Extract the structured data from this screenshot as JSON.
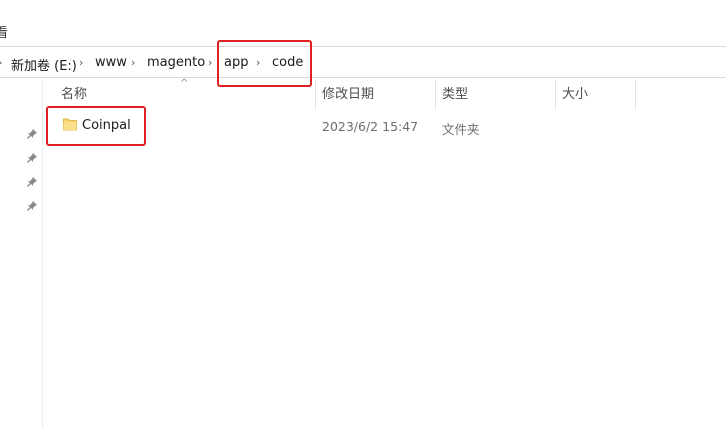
{
  "ribbon": {
    "partial_text": "看"
  },
  "address": {
    "crumbs": [
      {
        "label": "新加卷 (E:)"
      },
      {
        "label": "www"
      },
      {
        "label": "magento"
      },
      {
        "label": "app"
      },
      {
        "label": "code"
      }
    ],
    "separator": "›"
  },
  "columns": {
    "name": "名称",
    "modified": "修改日期",
    "type": "类型",
    "size": "大小"
  },
  "files": [
    {
      "name": "Coinpal",
      "modified": "2023/6/2 15:47",
      "type": "文件夹",
      "size": ""
    }
  ],
  "colors": {
    "highlight": "#e02020",
    "folder": "#f7d46b"
  }
}
